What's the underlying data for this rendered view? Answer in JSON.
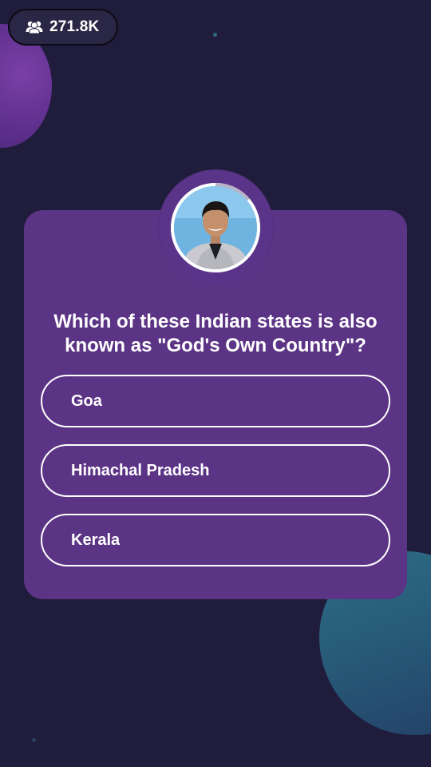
{
  "header": {
    "viewer_icon": "users-icon",
    "viewer_count": "271.8K"
  },
  "quiz": {
    "host_avatar": "host-avatar",
    "question": "Which of these Indian states is also known as \"God's Own Country\"?",
    "options": [
      {
        "label": "Goa"
      },
      {
        "label": "Himachal Pradesh"
      },
      {
        "label": "Kerala"
      }
    ]
  },
  "colors": {
    "background": "#201c3b",
    "card": "#5c3486",
    "option_border": "#ffffff",
    "accent_teal": "#2d6d85"
  }
}
